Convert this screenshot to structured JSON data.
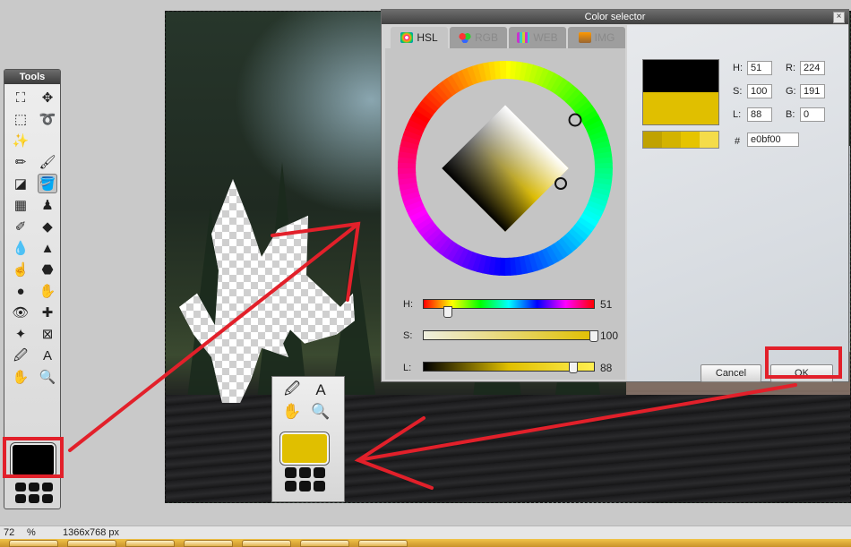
{
  "tools": {
    "title": "Tools",
    "items": [
      {
        "name": "crop-tool",
        "glyph": "⛶"
      },
      {
        "name": "move-tool",
        "glyph": "✥"
      },
      {
        "name": "marquee-tool",
        "glyph": "⬚"
      },
      {
        "name": "lasso-tool",
        "glyph": "➰"
      },
      {
        "name": "magic-wand-tool",
        "glyph": "✨"
      },
      {
        "name": "blank",
        "glyph": ""
      },
      {
        "name": "pencil-tool",
        "glyph": "✏"
      },
      {
        "name": "brush-tool",
        "glyph": "🖌"
      },
      {
        "name": "eraser-tool",
        "glyph": "◪"
      },
      {
        "name": "paint-bucket-tool",
        "glyph": "🪣"
      },
      {
        "name": "gradient-tool",
        "glyph": "▦"
      },
      {
        "name": "stamp-tool",
        "glyph": "♟"
      },
      {
        "name": "color-replace-tool",
        "glyph": "✐"
      },
      {
        "name": "shapes-tool",
        "glyph": "◆"
      },
      {
        "name": "blur-tool",
        "glyph": "💧"
      },
      {
        "name": "sharpen-tool",
        "glyph": "▲"
      },
      {
        "name": "smudge-tool",
        "glyph": "☝"
      },
      {
        "name": "sponge-tool",
        "glyph": "⬣"
      },
      {
        "name": "dodge-tool",
        "glyph": "●"
      },
      {
        "name": "burn-tool",
        "glyph": "✋"
      },
      {
        "name": "red-eye-tool",
        "glyph": "👁"
      },
      {
        "name": "spot-heal-tool",
        "glyph": "✚"
      },
      {
        "name": "bloat-tool",
        "glyph": "✦"
      },
      {
        "name": "pinch-tool",
        "glyph": "⊠"
      },
      {
        "name": "color-picker-tool",
        "glyph": "🖉"
      },
      {
        "name": "type-tool",
        "glyph": "A"
      },
      {
        "name": "hand-tool",
        "glyph": "✋"
      },
      {
        "name": "zoom-tool",
        "glyph": "🔍"
      }
    ]
  },
  "inset": {
    "items": [
      {
        "name": "color-picker-tool",
        "glyph": "🖉"
      },
      {
        "name": "type-tool",
        "glyph": "A"
      },
      {
        "name": "hand-tool",
        "glyph": "✋"
      },
      {
        "name": "zoom-tool",
        "glyph": "🔍"
      }
    ],
    "swatch_color": "#e0bf00"
  },
  "dialog": {
    "title": "Color selector",
    "close_label": "×",
    "tabs": [
      {
        "label": "HSL",
        "active": true
      },
      {
        "label": "RGB",
        "active": false
      },
      {
        "label": "WEB",
        "active": false
      },
      {
        "label": "IMG",
        "active": false
      }
    ],
    "sliders": {
      "h": {
        "label": "H:",
        "value": "51",
        "fraction": 0.14
      },
      "s": {
        "label": "S:",
        "value": "100",
        "fraction": 1.0
      },
      "l": {
        "label": "L:",
        "value": "88",
        "fraction": 0.88
      }
    },
    "fields": {
      "h": {
        "label": "H:",
        "value": "51"
      },
      "s": {
        "label": "S:",
        "value": "100"
      },
      "l": {
        "label": "L:",
        "value": "88"
      },
      "r": {
        "label": "R:",
        "value": "224"
      },
      "g": {
        "label": "G:",
        "value": "191"
      },
      "b": {
        "label": "B:",
        "value": "0"
      }
    },
    "hex": {
      "label": "#",
      "value": "e0bf00"
    },
    "old_color": "#000000",
    "new_color": "#e0bf00",
    "shades": [
      "#c0a200",
      "#d3b300",
      "#e6c400",
      "#f4dc4a"
    ],
    "cancel_label": "Cancel",
    "ok_label": "OK"
  },
  "status": {
    "zoom_value": "72",
    "zoom_unit": "%",
    "dimensions": "1366x768 px"
  }
}
